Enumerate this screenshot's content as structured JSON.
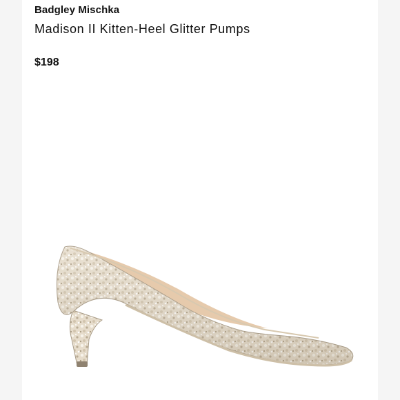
{
  "product": {
    "brand": "Badgley Mischka",
    "title": "Madison II Kitten-Heel Glitter Pumps",
    "price": "$198"
  },
  "image": {
    "subject": "glitter-pump-shoe",
    "colors": {
      "glitter_base": "#e6dccb",
      "glitter_highlight": "#f7f3ea",
      "glitter_shadow": "#b9ab93",
      "lining": "#e3c4a3",
      "heel_outline": "#a89b87"
    }
  }
}
